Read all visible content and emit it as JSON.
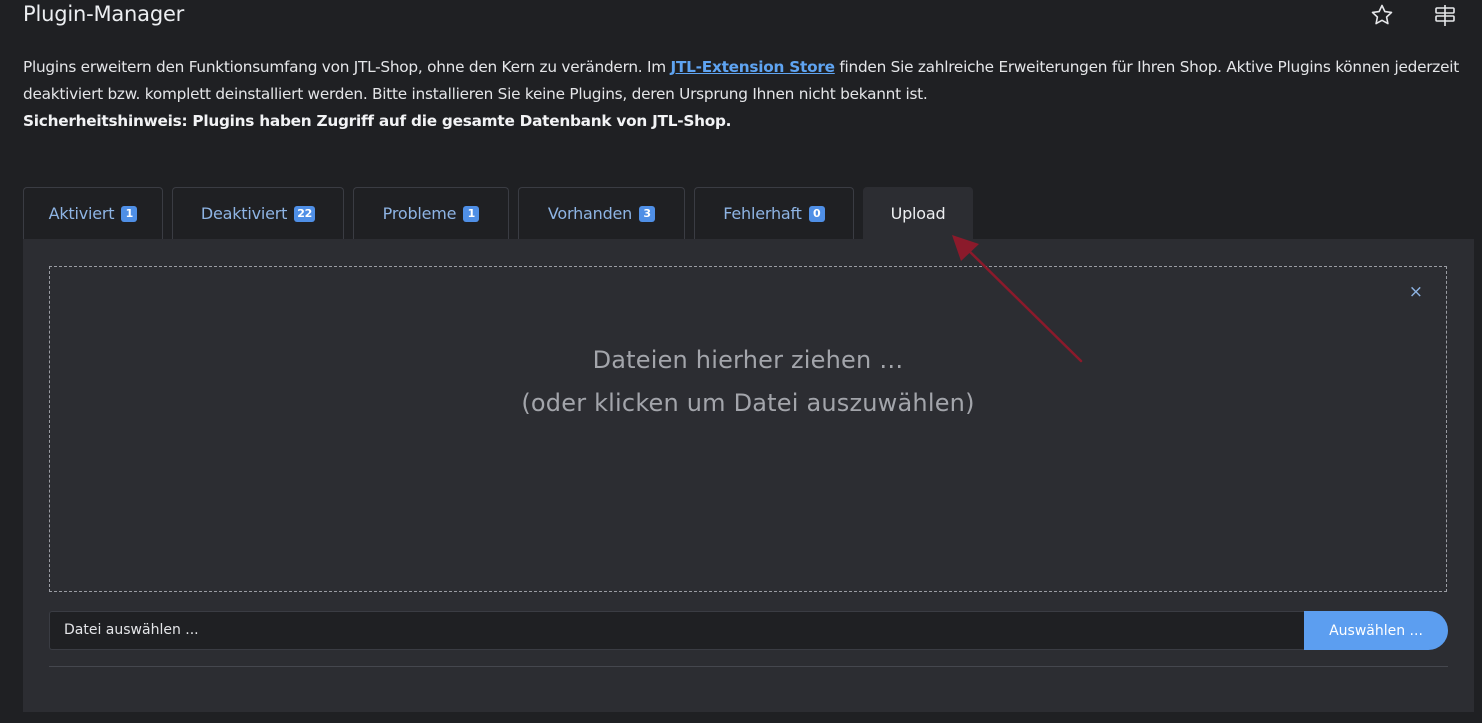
{
  "header": {
    "title": "Plugin-Manager",
    "icons": [
      "star-icon",
      "tours-icon"
    ]
  },
  "intro": {
    "text_before_link": "Plugins erweitern den Funktionsumfang von JTL-Shop, ohne den Kern zu verändern. Im ",
    "link_text": "JTL-Extension Store",
    "text_after_link": " finden Sie zahlreiche Erweiterungen für Ihren Shop. Aktive Plugins können jederzeit deaktiviert bzw. komplett deinstalliert werden. Bitte installieren Sie keine Plugins, deren Ursprung Ihnen nicht bekannt ist.",
    "warning": "Sicherheitshinweis: Plugins haben Zugriff auf die gesamte Datenbank von JTL-Shop."
  },
  "tabs": [
    {
      "label": "Aktiviert",
      "count": "1"
    },
    {
      "label": "Deaktiviert",
      "count": "22"
    },
    {
      "label": "Probleme",
      "count": "1"
    },
    {
      "label": "Vorhanden",
      "count": "3"
    },
    {
      "label": "Fehlerhaft",
      "count": "0"
    },
    {
      "label": "Upload",
      "count": null,
      "active": true
    }
  ],
  "upload": {
    "close_symbol": "×",
    "drop_line1": "Dateien hierher ziehen …",
    "drop_line2": "(oder klicken um Datei auszuwählen)",
    "file_placeholder": "Datei auswählen ...",
    "choose_button": "Auswählen ..."
  },
  "colors": {
    "background": "#1f2023",
    "panel": "#2c2d32",
    "accent": "#5c9ef0",
    "badge": "#4f8fe6",
    "annotation_arrow": "#8b1a2b"
  }
}
